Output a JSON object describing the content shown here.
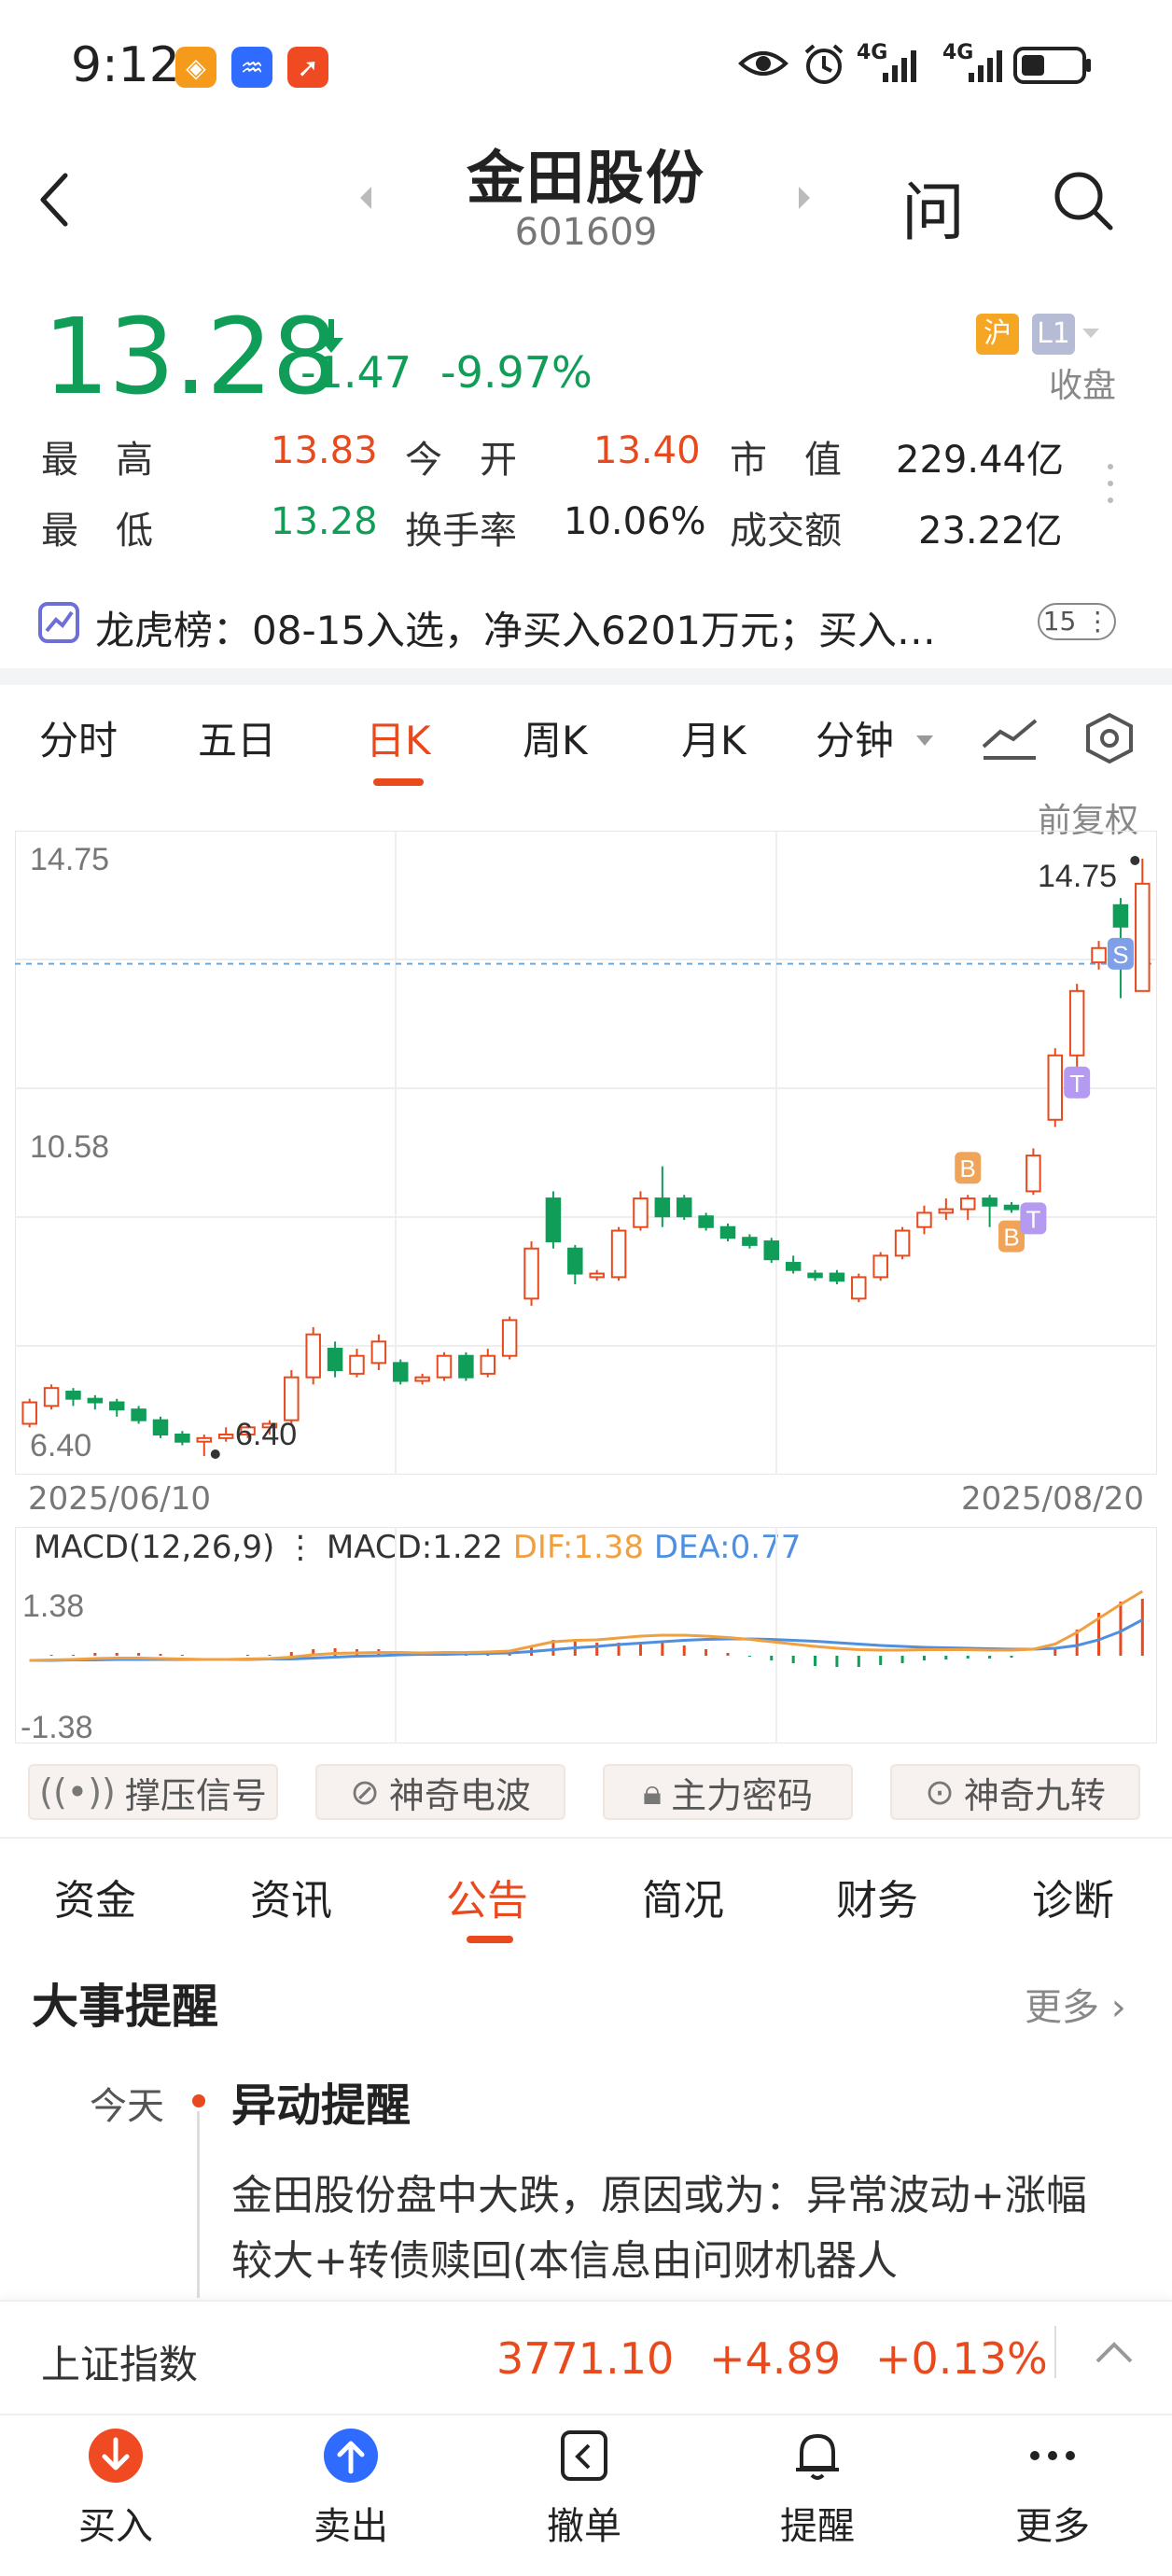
{
  "status_bar": {
    "time": "9:12",
    "network1": "4G",
    "network2": "4G",
    "colors": {
      "badge1": "#f59a1b",
      "badge2": "#2f6bff",
      "badge3": "#f04a23"
    }
  },
  "header": {
    "title": "金田股份",
    "code": "601609",
    "ask_label": "问"
  },
  "quote": {
    "price": "13.28",
    "change": "-1.47",
    "change_pct": "-9.97%",
    "market_badge": "沪",
    "level_badge": "L1",
    "status": "收盘",
    "stats": [
      {
        "label": "最　高",
        "value": "13.83"
      },
      {
        "label": "今　开",
        "value": "13.40"
      },
      {
        "label": "市　值",
        "value": "229.44亿"
      },
      {
        "label": "最　低",
        "value": "13.28"
      },
      {
        "label": "换手率",
        "value": "10.06%"
      },
      {
        "label": "成交额",
        "value": "23.22亿"
      }
    ],
    "dragon_tiger": "龙虎榜：08-15入选，净买入6201万元；买入…",
    "dragon_tiger_count": "15"
  },
  "kline_tabs": [
    "分时",
    "五日",
    "日K",
    "周K",
    "月K",
    "分钟"
  ],
  "active_kline_tab": "日K",
  "adjust_label": "前复权",
  "chart_data": {
    "type": "candlestick",
    "y_top_label": "14.75",
    "y_mid_label": "10.58",
    "y_bottom_label": "6.40",
    "max_marker": "14.75",
    "min_marker": "6.40",
    "x_start": "2025/06/10",
    "x_end": "2025/08/20",
    "ylim": [
      6.4,
      14.75
    ],
    "candles": [
      [
        6.85,
        7.15,
        6.8,
        7.2
      ],
      [
        7.1,
        7.35,
        7.05,
        7.4
      ],
      [
        7.3,
        7.2,
        7.1,
        7.35
      ],
      [
        7.2,
        7.15,
        7.05,
        7.25
      ],
      [
        7.15,
        7.05,
        6.95,
        7.2
      ],
      [
        7.05,
        6.9,
        6.85,
        7.1
      ],
      [
        6.9,
        6.7,
        6.65,
        6.95
      ],
      [
        6.7,
        6.6,
        6.55,
        6.75
      ],
      [
        6.6,
        6.65,
        6.4,
        6.7
      ],
      [
        6.65,
        6.7,
        6.6,
        6.8
      ],
      [
        6.7,
        6.8,
        6.65,
        6.85
      ],
      [
        6.8,
        6.85,
        6.7,
        6.9
      ],
      [
        6.9,
        7.5,
        6.85,
        7.6
      ],
      [
        7.5,
        8.1,
        7.4,
        8.2
      ],
      [
        7.9,
        7.6,
        7.5,
        8.0
      ],
      [
        7.55,
        7.8,
        7.5,
        7.9
      ],
      [
        7.7,
        8.0,
        7.6,
        8.1
      ],
      [
        7.7,
        7.45,
        7.4,
        7.75
      ],
      [
        7.45,
        7.5,
        7.4,
        7.55
      ],
      [
        7.5,
        7.8,
        7.45,
        7.85
      ],
      [
        7.8,
        7.5,
        7.45,
        7.85
      ],
      [
        7.55,
        7.8,
        7.5,
        7.9
      ],
      [
        7.8,
        8.3,
        7.75,
        8.35
      ],
      [
        8.6,
        9.3,
        8.5,
        9.4
      ],
      [
        10.0,
        9.4,
        9.3,
        10.1
      ],
      [
        9.3,
        8.95,
        8.8,
        9.35
      ],
      [
        8.9,
        8.95,
        8.85,
        9.0
      ],
      [
        8.9,
        9.55,
        8.85,
        9.6
      ],
      [
        9.6,
        10.0,
        9.55,
        10.1
      ],
      [
        10.0,
        9.75,
        9.6,
        10.45
      ],
      [
        10.0,
        9.75,
        9.7,
        10.05
      ],
      [
        9.75,
        9.6,
        9.55,
        9.8
      ],
      [
        9.6,
        9.45,
        9.4,
        9.65
      ],
      [
        9.45,
        9.35,
        9.3,
        9.5
      ],
      [
        9.4,
        9.15,
        9.1,
        9.45
      ],
      [
        9.1,
        9.0,
        8.95,
        9.2
      ],
      [
        8.95,
        8.9,
        8.85,
        9.0
      ],
      [
        8.95,
        8.85,
        8.8,
        9.0
      ],
      [
        8.6,
        8.9,
        8.55,
        8.95
      ],
      [
        8.9,
        9.2,
        8.85,
        9.25
      ],
      [
        9.2,
        9.55,
        9.15,
        9.6
      ],
      [
        9.6,
        9.8,
        9.5,
        9.9
      ],
      [
        9.8,
        9.85,
        9.7,
        10.0
      ],
      [
        9.85,
        10.0,
        9.7,
        10.05
      ],
      [
        10.0,
        9.9,
        9.6,
        10.05
      ],
      [
        9.9,
        9.85,
        9.8,
        9.95
      ],
      [
        10.1,
        10.6,
        10.05,
        10.7
      ],
      [
        11.1,
        12.0,
        11.0,
        12.1
      ],
      [
        12.0,
        12.9,
        11.4,
        13.0
      ],
      [
        13.3,
        13.5,
        13.2,
        13.6
      ],
      [
        14.1,
        13.8,
        12.8,
        14.2
      ],
      [
        12.9,
        14.4,
        12.9,
        14.75
      ]
    ],
    "ref_line": 13.28,
    "markers": [
      {
        "label": "S",
        "index": 50,
        "color": "#7f9fe8"
      },
      {
        "label": "T",
        "index": 48,
        "color": "#b49af0"
      },
      {
        "label": "B",
        "index": 43,
        "color": "#f0a45a"
      },
      {
        "label": "B",
        "index": 45,
        "color": "#f0a45a"
      },
      {
        "label": "T",
        "index": 46,
        "color": "#b49af0"
      }
    ]
  },
  "macd": {
    "title": "MACD(12,26,9)",
    "macd": "MACD:1.22",
    "dif": "DIF:1.38",
    "dea": "DEA:0.77",
    "y_top": "1.38",
    "y_bottom": "-1.38",
    "dif_series": [
      -0.1,
      -0.09,
      -0.08,
      -0.06,
      -0.05,
      -0.05,
      -0.06,
      -0.07,
      -0.08,
      -0.08,
      -0.07,
      -0.06,
      -0.03,
      0.02,
      0.05,
      0.06,
      0.07,
      0.07,
      0.06,
      0.07,
      0.07,
      0.08,
      0.1,
      0.2,
      0.3,
      0.33,
      0.34,
      0.38,
      0.42,
      0.44,
      0.44,
      0.42,
      0.39,
      0.35,
      0.3,
      0.25,
      0.2,
      0.16,
      0.13,
      0.12,
      0.12,
      0.13,
      0.13,
      0.13,
      0.12,
      0.12,
      0.14,
      0.25,
      0.5,
      0.8,
      1.1,
      1.38
    ],
    "dea_series": [
      -0.1,
      -0.1,
      -0.09,
      -0.09,
      -0.08,
      -0.08,
      -0.08,
      -0.08,
      -0.08,
      -0.08,
      -0.08,
      -0.07,
      -0.07,
      -0.05,
      -0.03,
      -0.01,
      0.0,
      0.02,
      0.03,
      0.03,
      0.04,
      0.05,
      0.06,
      0.09,
      0.13,
      0.17,
      0.2,
      0.24,
      0.27,
      0.3,
      0.33,
      0.35,
      0.36,
      0.36,
      0.35,
      0.33,
      0.31,
      0.28,
      0.25,
      0.22,
      0.2,
      0.18,
      0.17,
      0.16,
      0.15,
      0.14,
      0.14,
      0.16,
      0.22,
      0.34,
      0.52,
      0.77
    ],
    "hist": [
      0,
      0.02,
      0.02,
      0.06,
      0.06,
      0.06,
      0.04,
      0.02,
      0,
      0,
      0.02,
      0.02,
      0.08,
      0.14,
      0.16,
      0.14,
      0.14,
      0.1,
      0.06,
      0.08,
      0.06,
      0.06,
      0.08,
      0.22,
      0.34,
      0.32,
      0.28,
      0.28,
      0.3,
      0.28,
      0.22,
      0.14,
      0.06,
      -0.02,
      -0.1,
      -0.16,
      -0.22,
      -0.24,
      -0.24,
      -0.2,
      -0.16,
      -0.1,
      -0.08,
      -0.06,
      -0.06,
      -0.04,
      0,
      0.18,
      0.56,
      0.92,
      1.16,
      1.22
    ]
  },
  "signal_chips": [
    "撑压信号",
    "神奇电波",
    "主力密码",
    "神奇九转"
  ],
  "bottom_tabs": [
    "资金",
    "资讯",
    "公告",
    "简况",
    "财务",
    "诊断"
  ],
  "active_bottom_tab": "公告",
  "events": {
    "title": "大事提醒",
    "more": "更多",
    "date": "今天",
    "event_title": "异动提醒",
    "event_body": "金田股份盘中大跌，原因或为：异常波动+涨幅较大+转债赎回(本信息由问财机器人"
  },
  "index_bar": {
    "name": "上证指数",
    "value": "3771.10",
    "change": "+4.89",
    "change_pct": "+0.13%"
  },
  "nav": [
    "买入",
    "卖出",
    "撤单",
    "提醒",
    "更多"
  ]
}
